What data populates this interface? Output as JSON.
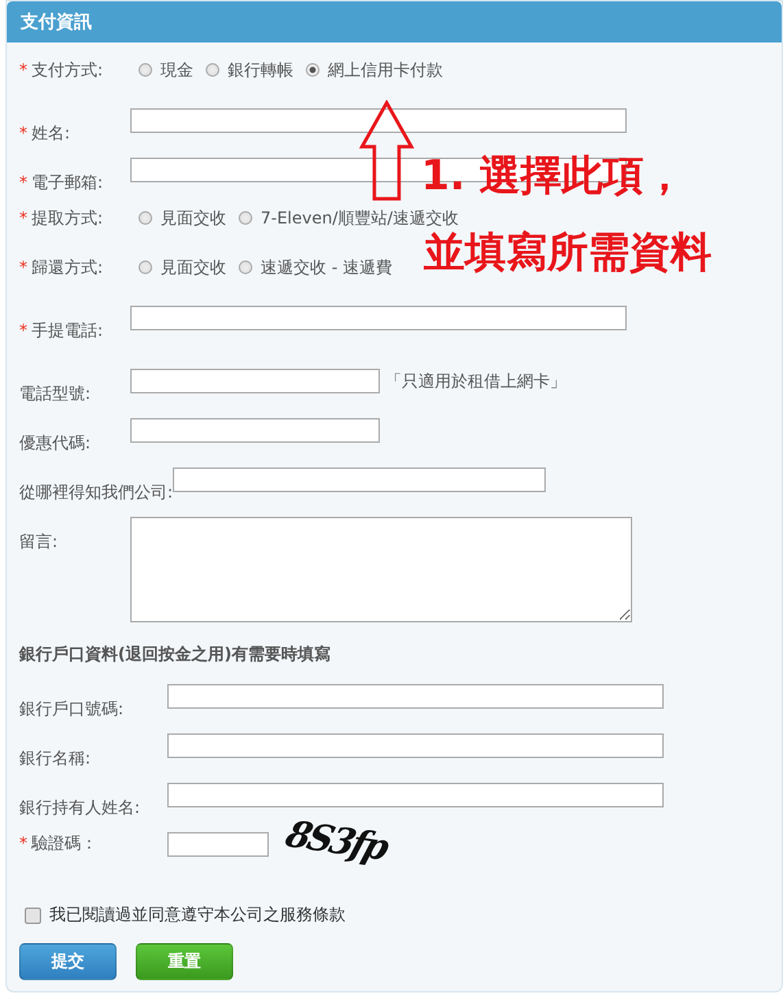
{
  "panel": {
    "title": "支付資訊"
  },
  "sections": [
    {
      "rows": [
        {
          "kind": "radio",
          "mark": "*",
          "label": "支付方式:",
          "options": [
            {
              "label": "現金",
              "selected": false
            },
            {
              "label": "銀行轉帳",
              "selected": false
            },
            {
              "label": "網上信用卡付款",
              "selected": true
            }
          ]
        },
        {
          "kind": "text",
          "mark": "*",
          "label": "姓名:"
        },
        {
          "kind": "text",
          "mark": "*",
          "label": "電子郵箱:"
        },
        {
          "kind": "radio",
          "mark": "*",
          "label": "提取方式:",
          "options": [
            {
              "label": "見面交收",
              "selected": false
            },
            {
              "label": "7-Eleven/順豐站/速遞交收",
              "selected": false
            }
          ]
        },
        {
          "kind": "radio",
          "mark": "*",
          "label": "歸還方式:",
          "options": [
            {
              "label": "見面交收",
              "selected": false
            },
            {
              "label": "速遞交收 - 速遞費",
              "selected": false
            }
          ]
        },
        {
          "kind": "text",
          "mark": "*",
          "label": "手提電話:"
        },
        {
          "kind": "short",
          "label": "電話型號:",
          "note": "「只適用於租借上網卡」"
        },
        {
          "kind": "short",
          "label": "優惠代碼:"
        },
        {
          "kind": "medium",
          "label": "從哪裡得知我們公司:"
        },
        {
          "kind": "textarea",
          "label": "留言:"
        }
      ]
    },
    {
      "heading": "銀行戶口資料(退回按金之用)有需要時填寫",
      "rows": [
        {
          "kind": "text",
          "label": "銀行戶口號碼:"
        },
        {
          "kind": "text",
          "label": "銀行名稱:"
        },
        {
          "kind": "text",
          "label": "銀行持有人姓名:"
        },
        {
          "kind": "captcha",
          "mark": "*",
          "label": "驗證碼：",
          "captcha": "8S3fp"
        }
      ]
    }
  ],
  "agreement": {
    "label": "我已閱讀過並同意遵守本公司之服務條款",
    "checked": false
  },
  "buttons": [
    {
      "kind": "submit",
      "label": "提交"
    },
    {
      "kind": "reset",
      "label": "重置"
    }
  ],
  "annotation": {
    "lines": [
      "1. 選擇此項，",
      "並填寫所需資料"
    ]
  }
}
